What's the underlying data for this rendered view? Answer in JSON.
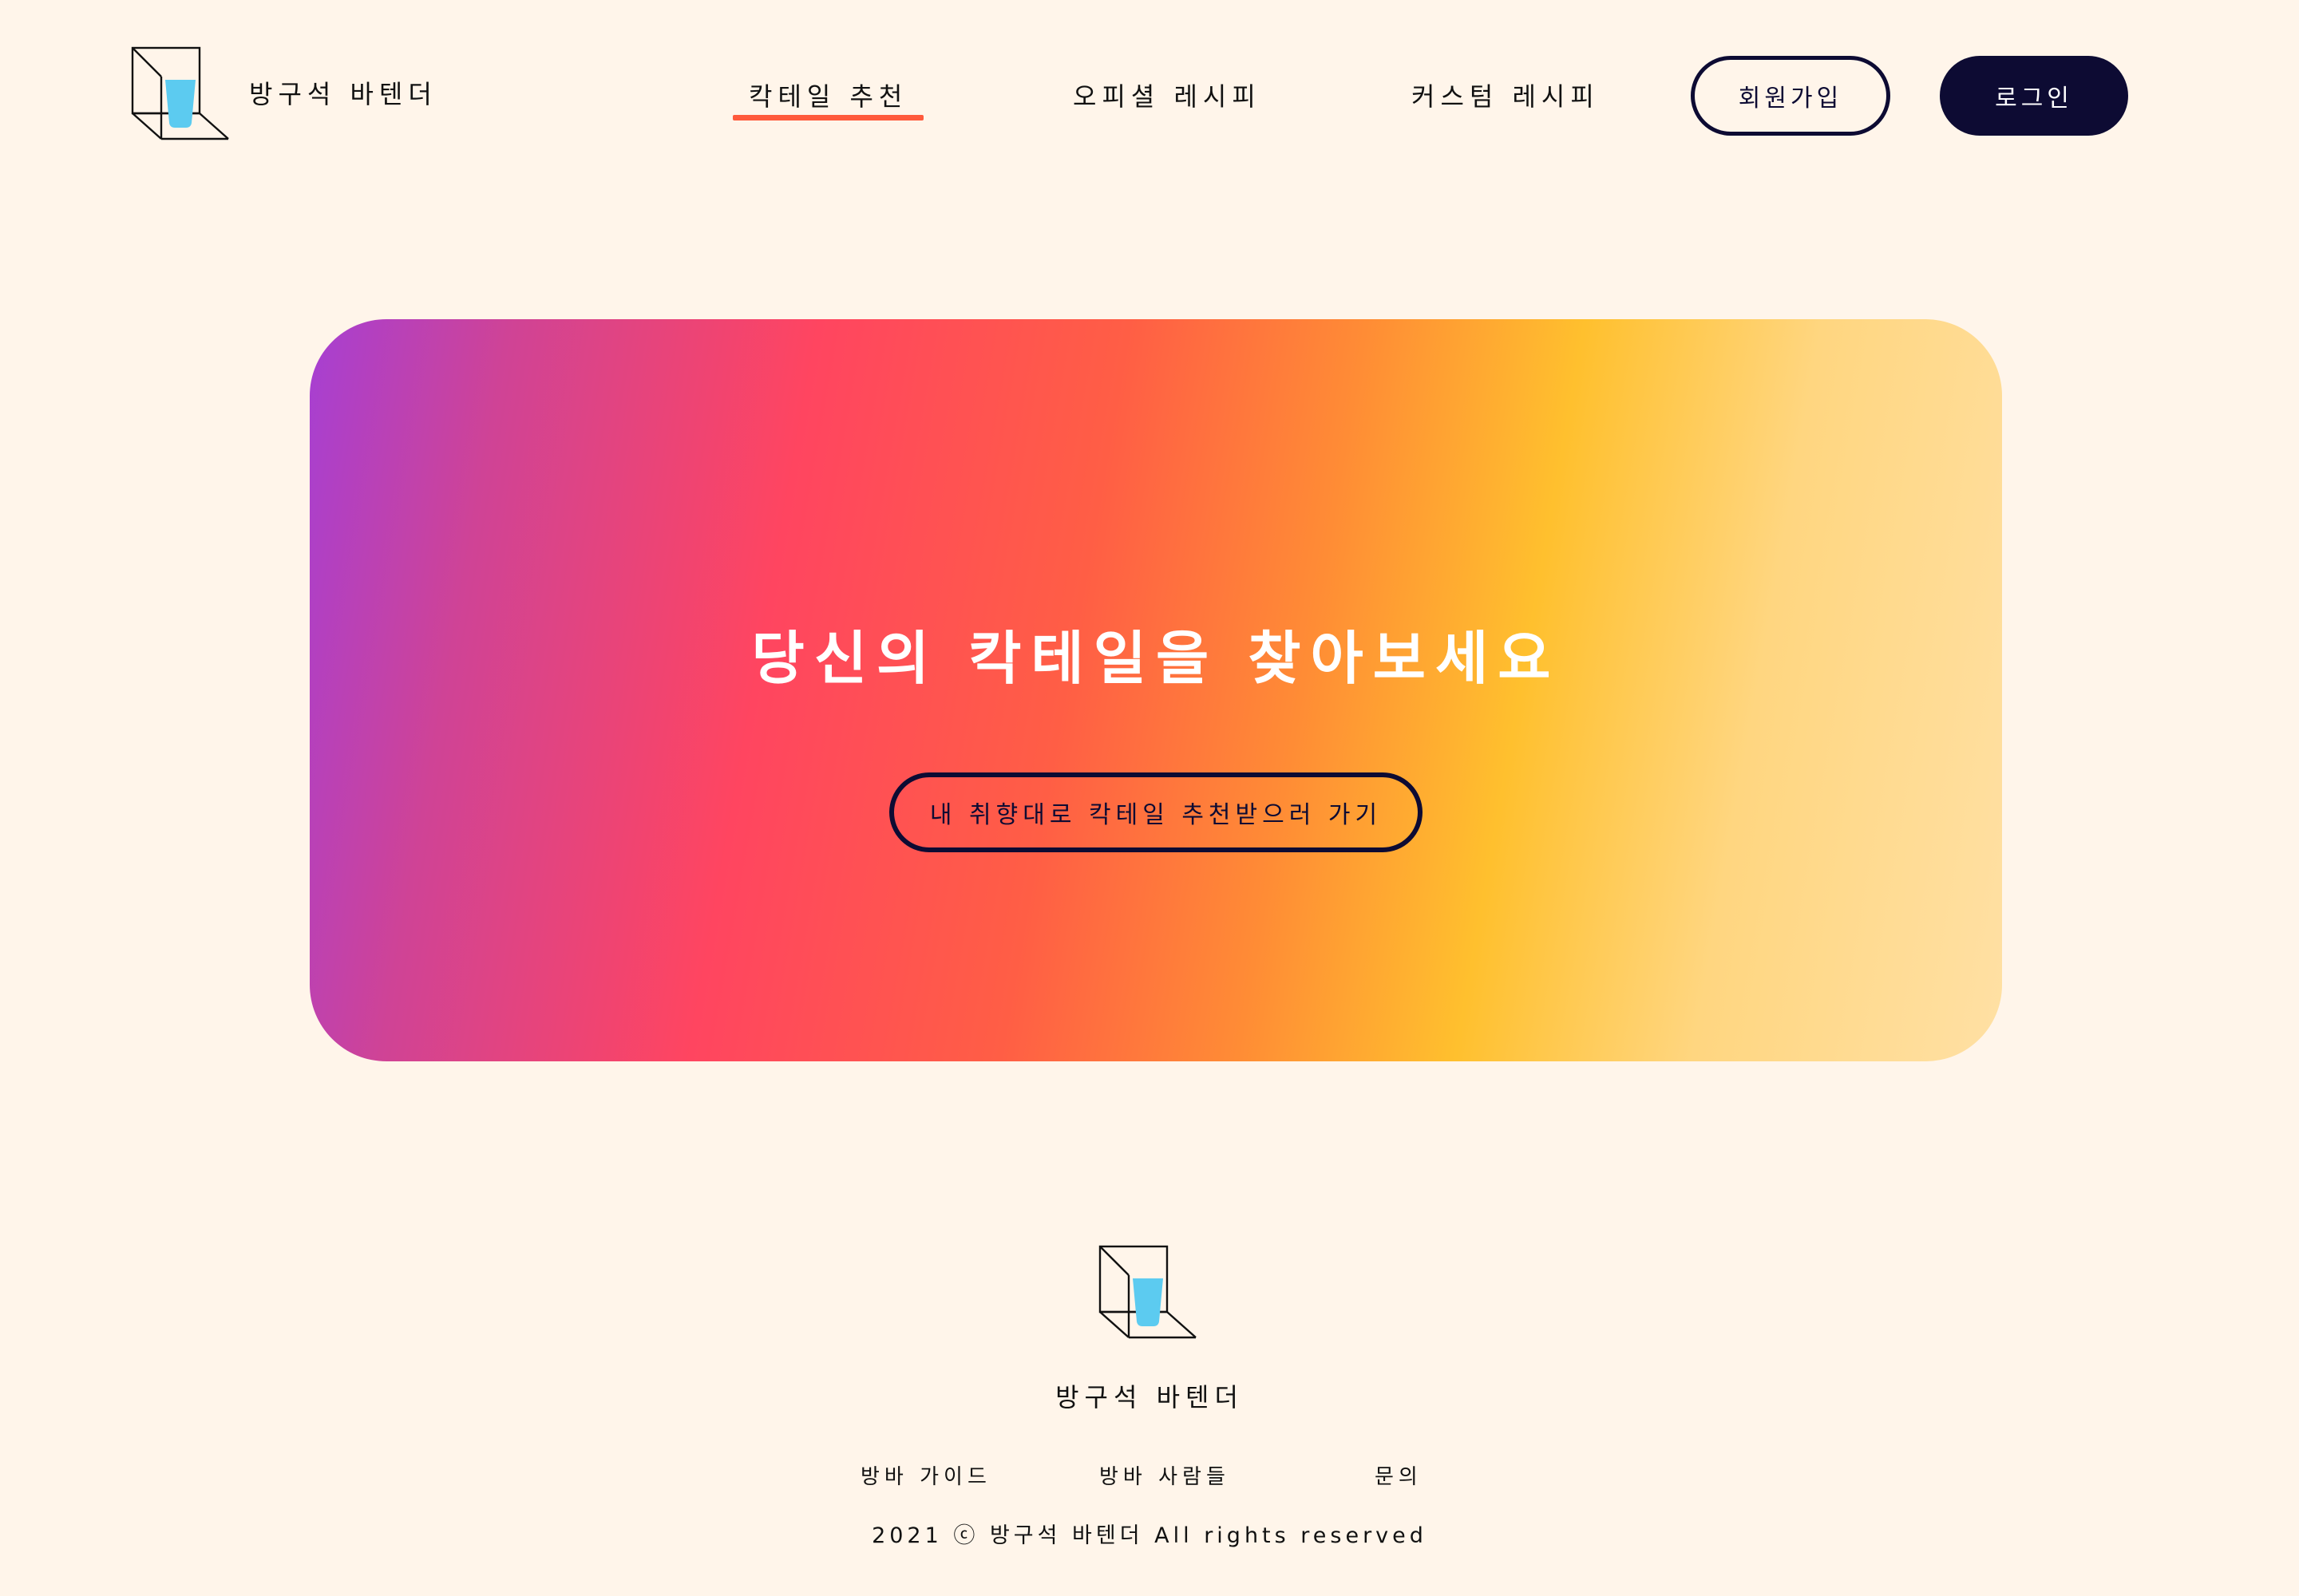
{
  "brand": {
    "name": "방구석 바텐더"
  },
  "nav": {
    "items": [
      {
        "label": "칵테일 추천",
        "active": true
      },
      {
        "label": "오피셜 레시피",
        "active": false
      },
      {
        "label": "커스텀 레시피",
        "active": false
      }
    ],
    "signup_label": "회원가입",
    "login_label": "로그인"
  },
  "hero": {
    "title": "당신의 칵테일을 찾아보세요",
    "cta_label": "내 취향대로 칵테일 추천받으러 가기"
  },
  "footer": {
    "brand": "방구석 바텐더",
    "links": [
      "방바 가이드",
      "방바 사람들",
      "문의"
    ],
    "copyright": "2021 ⓒ 방구석 바텐더 All rights reserved"
  },
  "icons": {
    "logo": "glass-in-cube-logo-icon"
  },
  "colors": {
    "background": "#fff5ea",
    "navy": "#0d0b33",
    "active_underline": "#ff5a3c",
    "logo_glass": "#5ccbf0",
    "hero_gradient": [
      "#a63fd3",
      "#ff4560",
      "#ff5e45",
      "#ffc02e",
      "#ffe0a4"
    ]
  }
}
